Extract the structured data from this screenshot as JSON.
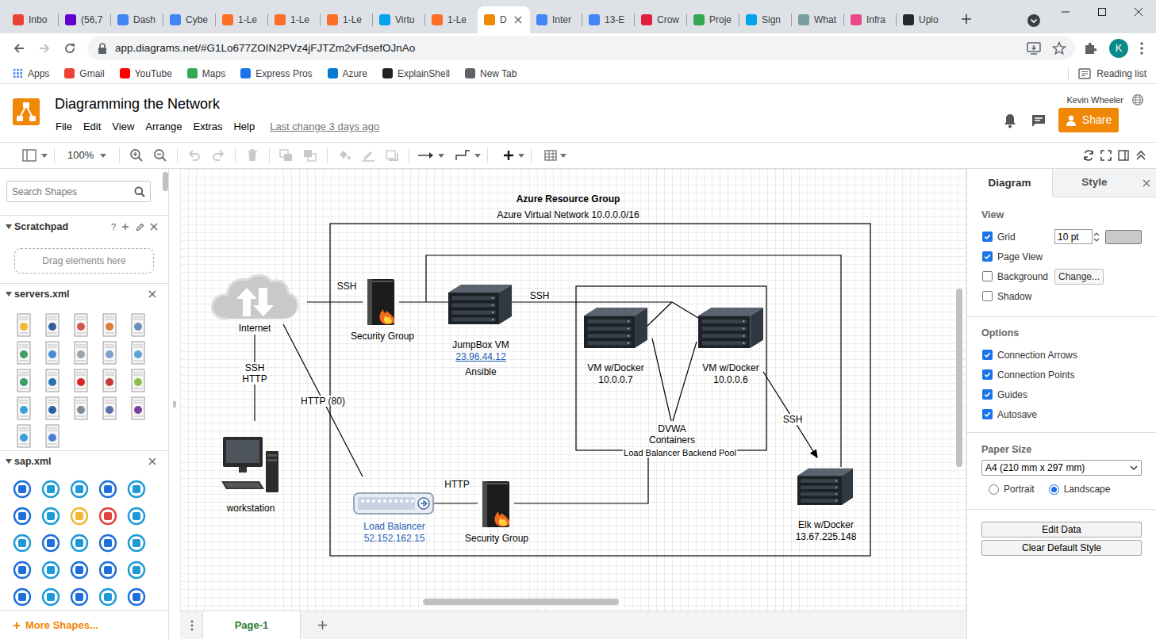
{
  "browser": {
    "tabs": [
      {
        "label": "Inbo",
        "selected": false,
        "color": "#ea4335"
      },
      {
        "label": "(56,7",
        "selected": false,
        "color": "#6001d2"
      },
      {
        "label": "Dash",
        "selected": false,
        "color": "#4285f4"
      },
      {
        "label": "Cybe",
        "selected": false,
        "color": "#4285f4"
      },
      {
        "label": "1-Le",
        "selected": false,
        "color": "#fc6d26"
      },
      {
        "label": "1-Le",
        "selected": false,
        "color": "#fc6d26"
      },
      {
        "label": "1-Le",
        "selected": false,
        "color": "#fc6d26"
      },
      {
        "label": "Virtu",
        "selected": false,
        "color": "#00a4ef"
      },
      {
        "label": "1-Le",
        "selected": false,
        "color": "#fc6d26"
      },
      {
        "label": "D",
        "selected": true,
        "color": "#f08705"
      },
      {
        "label": "Inter",
        "selected": false,
        "color": "#4285f4"
      },
      {
        "label": "13-E",
        "selected": false,
        "color": "#4285f4"
      },
      {
        "label": "Crow",
        "selected": false,
        "color": "#e01f3d"
      },
      {
        "label": "Proje",
        "selected": false,
        "color": "#34a853"
      },
      {
        "label": "Sign",
        "selected": false,
        "color": "#00a4ef"
      },
      {
        "label": "What",
        "selected": false,
        "color": "#7a9e9f"
      },
      {
        "label": "Infra",
        "selected": false,
        "color": "#e8488a"
      },
      {
        "label": "Uplo",
        "selected": false,
        "color": "#24292e"
      }
    ],
    "url": "app.diagrams.net/#G1Lo677ZOIN2PVz4jFJTZm2vFdsefOJnAo",
    "profile": "K",
    "bookmarks": [
      {
        "label": "Apps",
        "color": "#4285f4"
      },
      {
        "label": "Gmail",
        "color": "#ea4335"
      },
      {
        "label": "YouTube",
        "color": "#ff0000"
      },
      {
        "label": "Maps",
        "color": "#34a853"
      },
      {
        "label": "Express Pros",
        "color": "#1a73e8"
      },
      {
        "label": "Azure",
        "color": "#0078d4"
      },
      {
        "label": "ExplainShell",
        "color": "#202124"
      },
      {
        "label": "New Tab",
        "color": "#5f6368"
      }
    ],
    "reading_list": "Reading list"
  },
  "app": {
    "title": "Diagramming the Network",
    "menu": [
      "File",
      "Edit",
      "View",
      "Arrange",
      "Extras",
      "Help"
    ],
    "last_change": "Last change 3 days ago",
    "user": "Kevin Wheeler",
    "share": "Share"
  },
  "toolbar": {
    "zoom": "100%"
  },
  "sidebar": {
    "search_placeholder": "Search Shapes",
    "scratchpad": {
      "title": "Scratchpad",
      "help": "?",
      "drop_hint": "Drag elements here"
    },
    "libraries": [
      "servers.xml",
      "sap.xml"
    ],
    "more_shapes": "More Shapes..."
  },
  "diagram": {
    "texts": [
      {
        "text": "Azure Resource Group",
        "bold": true
      },
      {
        "text": "Azure Virtual Network 10.0.0.0/16",
        "bold": false
      },
      {
        "text": "DVWA",
        "bold": false
      },
      {
        "text": "Containers",
        "bold": false
      },
      {
        "text": "Load Balancer Backend Pool",
        "bold": false
      }
    ],
    "nodes": [
      {
        "kind": "cloud",
        "labels": [
          {
            "text": "Internet",
            "link": false
          }
        ]
      },
      {
        "kind": "firewall",
        "labels": [
          {
            "text": "Security Group",
            "link": false
          }
        ]
      },
      {
        "kind": "server",
        "labels": [
          {
            "text": "JumpBox VM",
            "link": false
          },
          {
            "text": "23.96.44.12",
            "link": true
          },
          {
            "text": "Ansible",
            "link": false
          }
        ]
      },
      {
        "kind": "server",
        "labels": [
          {
            "text": "VM w/Docker",
            "link": false
          },
          {
            "text": "10.0.0.7",
            "link": false
          }
        ]
      },
      {
        "kind": "server",
        "labels": [
          {
            "text": "VM w/Docker",
            "link": false
          },
          {
            "text": "10.0.0.6",
            "link": false
          }
        ]
      },
      {
        "kind": "server",
        "labels": [
          {
            "text": "Elk w/Docker",
            "link": false
          },
          {
            "text": "13.67.225.148",
            "link": false
          }
        ]
      },
      {
        "kind": "workstation",
        "labels": [
          {
            "text": "workstation",
            "link": false
          }
        ]
      },
      {
        "kind": "loadbalancer",
        "labels": [
          {
            "text": "Load Balancer",
            "link": false,
            "color": "#1f5fb8"
          },
          {
            "text": "52.152.162.15",
            "link": false,
            "color": "#1f5fb8"
          }
        ]
      },
      {
        "kind": "firewall",
        "labels": [
          {
            "text": "Security Group",
            "link": false
          }
        ]
      }
    ],
    "edge_labels": [
      "SSH",
      "SSH",
      "SSH",
      "HTTP",
      "HTTP (80)",
      "HTTP",
      "SSH"
    ]
  },
  "pages": [
    {
      "label": "Page-1",
      "selected": true
    }
  ],
  "panel": {
    "tabs": [
      {
        "label": "Diagram",
        "selected": true
      },
      {
        "label": "Style",
        "selected": false
      }
    ],
    "view": {
      "title": "View",
      "items": [
        {
          "label": "Grid",
          "checked": true
        },
        {
          "label": "Page View",
          "checked": true
        },
        {
          "label": "Background",
          "checked": false
        },
        {
          "label": "Shadow",
          "checked": false
        }
      ],
      "grid_size": "10 pt",
      "background_button": "Change..."
    },
    "options": {
      "title": "Options",
      "items": [
        {
          "label": "Connection Arrows",
          "checked": true
        },
        {
          "label": "Connection Points",
          "checked": true
        },
        {
          "label": "Guides",
          "checked": true
        },
        {
          "label": "Autosave",
          "checked": true
        }
      ]
    },
    "paper": {
      "title": "Paper Size",
      "size": "A4 (210 mm x 297 mm)",
      "orientation": [
        {
          "label": "Portrait",
          "selected": false
        },
        {
          "label": "Landscape",
          "selected": true
        }
      ]
    },
    "buttons": [
      "Edit Data",
      "Clear Default Style"
    ]
  }
}
